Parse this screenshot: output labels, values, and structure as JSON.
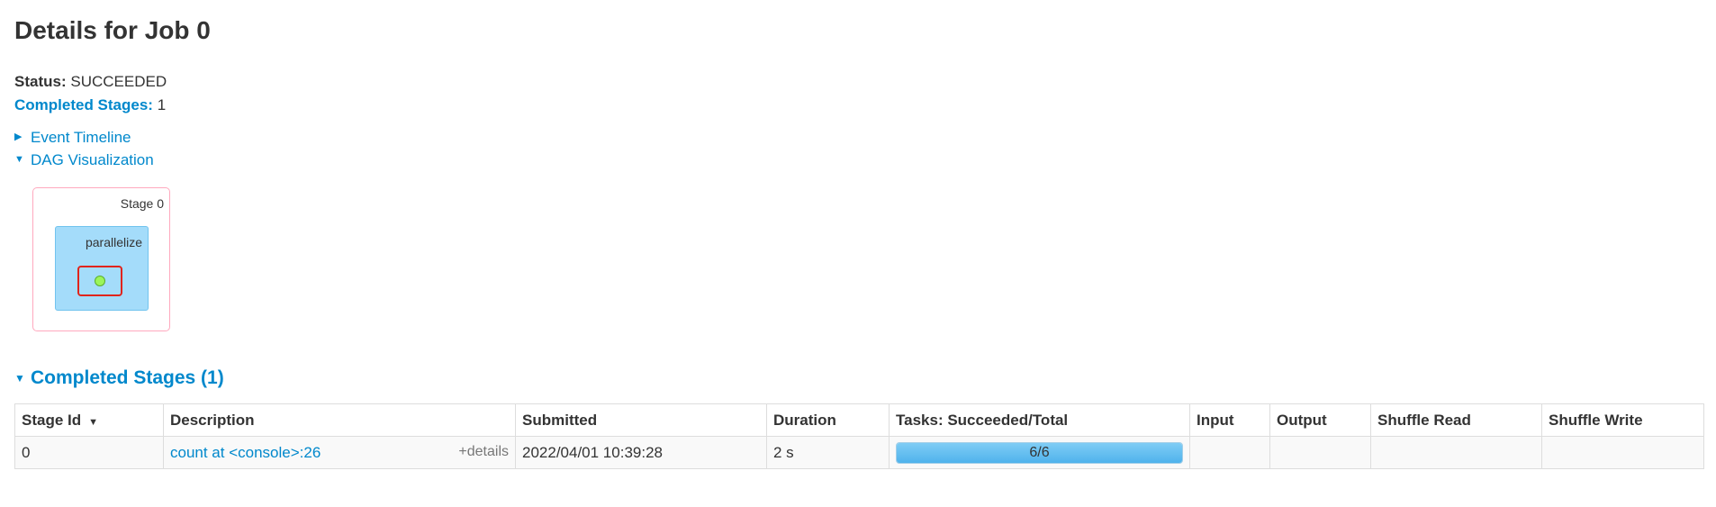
{
  "page": {
    "title": "Details for Job 0"
  },
  "summary": {
    "status_label": "Status:",
    "status_value": "SUCCEEDED",
    "completed_label": "Completed Stages:",
    "completed_value": "1"
  },
  "toggles": {
    "event_timeline": "Event Timeline",
    "dag_visualization": "DAG Visualization"
  },
  "dag": {
    "stage_label": "Stage 0",
    "cluster_label": "parallelize"
  },
  "completed_section": {
    "title": "Completed Stages (1)"
  },
  "table": {
    "headers": [
      "Stage Id",
      "Description",
      "Submitted",
      "Duration",
      "Tasks: Succeeded/Total",
      "Input",
      "Output",
      "Shuffle Read",
      "Shuffle Write"
    ],
    "rows": [
      {
        "stage_id": "0",
        "description": "count at <console>:26",
        "details": "+details",
        "submitted": "2022/04/01 10:39:28",
        "duration": "2 s",
        "tasks_text": "6/6",
        "tasks_fraction": 1.0,
        "input": "",
        "output": "",
        "shuffle_read": "",
        "shuffle_write": ""
      }
    ]
  },
  "icons": {
    "collapsed": "triangle-right-icon",
    "expanded": "triangle-down-icon",
    "sort": "sort-desc-icon"
  }
}
